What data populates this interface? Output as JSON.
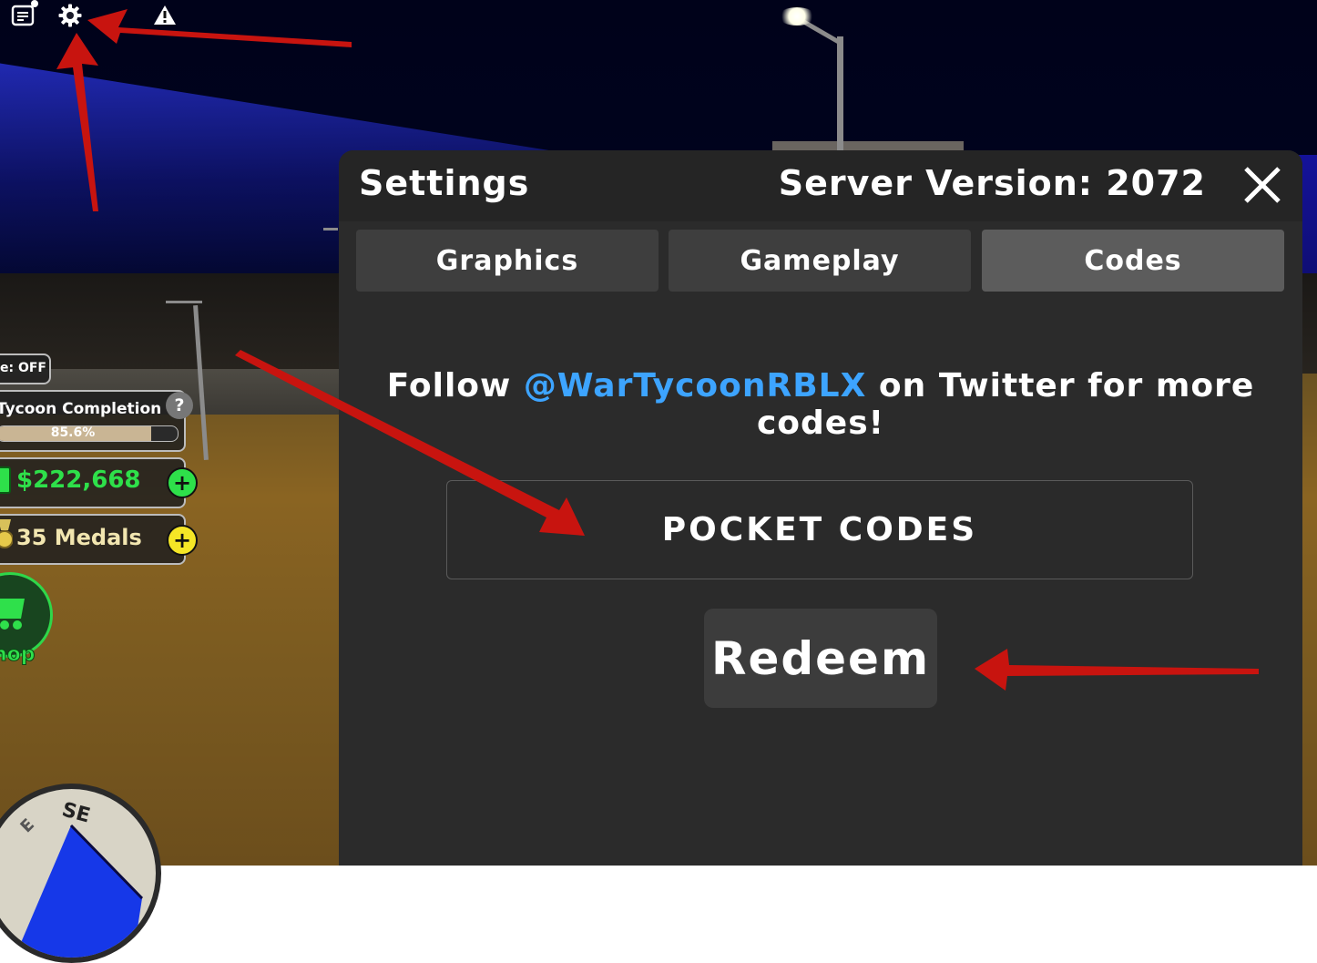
{
  "hud": {
    "mode_text": "e: OFF",
    "tycoon_label": "Tycoon Completion",
    "tycoon_progress": 0.856,
    "tycoon_progress_text": "85.6%",
    "help_symbol": "?",
    "cash": "$222,668",
    "medals": "35 Medals",
    "plus_symbol": "+",
    "shop_label": "hop",
    "compass": {
      "se": "SE",
      "e": "E"
    },
    "colors": {
      "cash": "#2ee04a",
      "medals_plus": "#f5e626",
      "cash_plus": "#2ee04a"
    }
  },
  "topbar": {
    "icons": [
      "chat-icon",
      "settings-gear-icon",
      "warning-icon"
    ]
  },
  "settings": {
    "title": "Settings",
    "server_version": "Server Version: 2072",
    "tabs": [
      {
        "label": "Graphics",
        "active": false
      },
      {
        "label": "Gameplay",
        "active": false
      },
      {
        "label": "Codes",
        "active": true
      }
    ],
    "follow_prefix": "Follow",
    "follow_handle": "@WarTycoonRBLX",
    "follow_suffix": "on Twitter for more codes!",
    "code_input": {
      "value": "",
      "placeholder": "POCKET CODES"
    },
    "redeem_label": "Redeem",
    "colors": {
      "handle": "#3da4ff",
      "panel": "#2b2b2b",
      "active_tab": "#5c5c5c"
    }
  },
  "annotations": {
    "arrow_color": "#c8140f"
  }
}
